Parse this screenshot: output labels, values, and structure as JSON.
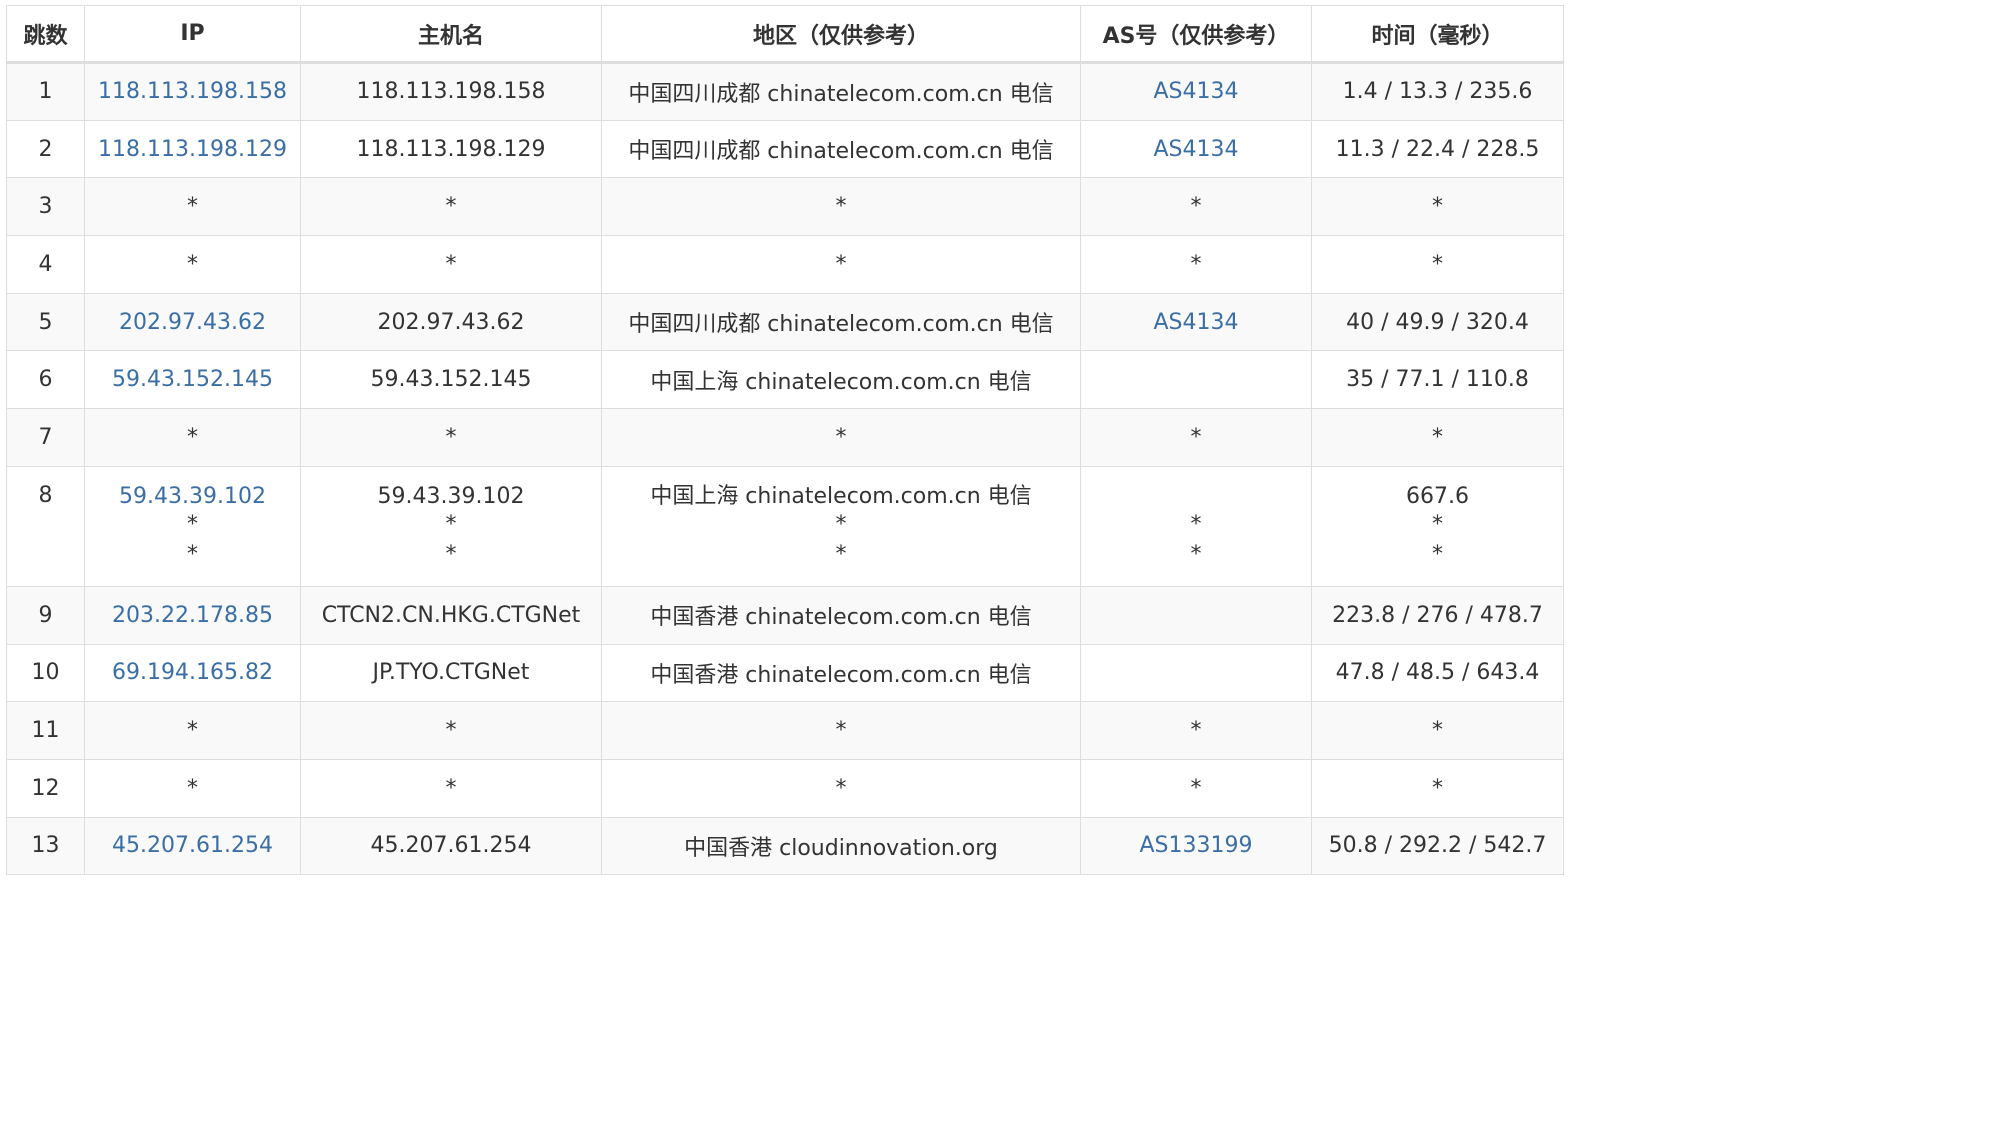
{
  "columns": [
    "跳数",
    "IP",
    "主机名",
    "地区（仅供参考）",
    "AS号（仅供参考）",
    "时间（毫秒）"
  ],
  "rows": [
    {
      "hop": "1",
      "ip": "118.113.198.158",
      "host": "118.113.198.158",
      "region": "中国四川成都 chinatelecom.com.cn 电信",
      "as": "AS4134",
      "time": "1.4 / 13.3 / 235.6"
    },
    {
      "hop": "2",
      "ip": "118.113.198.129",
      "host": "118.113.198.129",
      "region": "中国四川成都 chinatelecom.com.cn 电信",
      "as": "AS4134",
      "time": "11.3 / 22.4 / 228.5"
    },
    {
      "hop": "3",
      "ip": "*",
      "host": "*",
      "region": "*",
      "as": "*",
      "time": "*"
    },
    {
      "hop": "4",
      "ip": "*",
      "host": "*",
      "region": "*",
      "as": "*",
      "time": "*"
    },
    {
      "hop": "5",
      "ip": "202.97.43.62",
      "host": "202.97.43.62",
      "region": "中国四川成都 chinatelecom.com.cn 电信",
      "as": "AS4134",
      "time": "40 / 49.9 / 320.4"
    },
    {
      "hop": "6",
      "ip": "59.43.152.145",
      "host": "59.43.152.145",
      "region": "中国上海 chinatelecom.com.cn 电信",
      "as": "",
      "time": "35 / 77.1 / 110.8"
    },
    {
      "hop": "7",
      "ip": "*",
      "host": "*",
      "region": "*",
      "as": "*",
      "time": "*"
    },
    {
      "hop": "8",
      "ip": [
        "59.43.39.102",
        "*",
        "*"
      ],
      "host": [
        "59.43.39.102",
        "*",
        "*"
      ],
      "region": [
        "中国上海 chinatelecom.com.cn 电信",
        "*",
        "*"
      ],
      "as": [
        "",
        "*",
        "*"
      ],
      "time": [
        "667.6",
        "*",
        "*"
      ]
    },
    {
      "hop": "9",
      "ip": "203.22.178.85",
      "host": "CTCN2.CN.HKG.CTGNet",
      "region": "中国香港 chinatelecom.com.cn 电信",
      "as": "",
      "time": "223.8 / 276 / 478.7"
    },
    {
      "hop": "10",
      "ip": "69.194.165.82",
      "host": "JP.TYO.CTGNet",
      "region": "中国香港 chinatelecom.com.cn 电信",
      "as": "",
      "time": "47.8 / 48.5 / 643.4"
    },
    {
      "hop": "11",
      "ip": "*",
      "host": "*",
      "region": "*",
      "as": "*",
      "time": "*"
    },
    {
      "hop": "12",
      "ip": "*",
      "host": "*",
      "region": "*",
      "as": "*",
      "time": "*"
    },
    {
      "hop": "13",
      "ip": "45.207.61.254",
      "host": "45.207.61.254",
      "region": "中国香港 cloudinnovation.org",
      "as": "AS133199",
      "time": "50.8 / 292.2 / 542.7"
    }
  ]
}
